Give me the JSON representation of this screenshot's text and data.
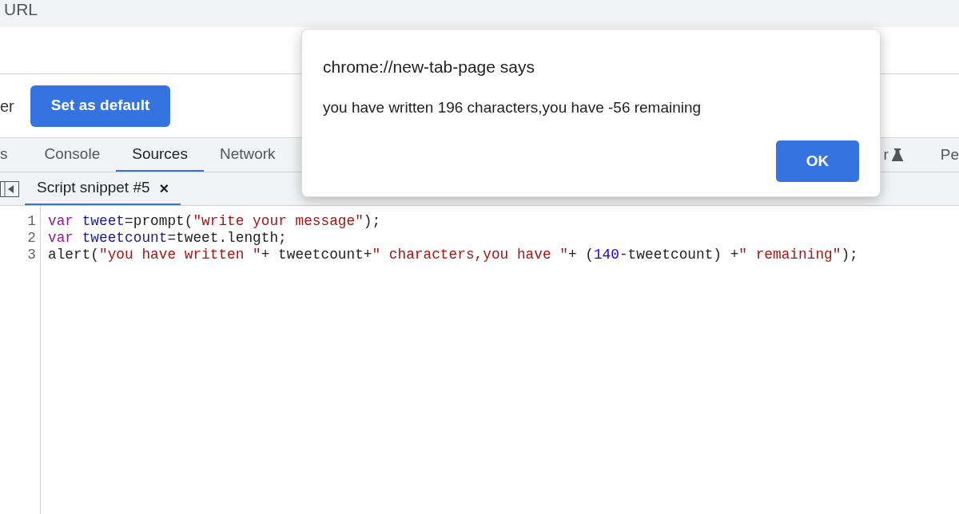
{
  "address_bar": {
    "text": "URL"
  },
  "banner": {
    "text": "er",
    "button": "Set as default"
  },
  "devtools_tabs": [
    {
      "label": "s",
      "selected": false
    },
    {
      "label": "Console",
      "selected": false
    },
    {
      "label": "Sources",
      "selected": true
    },
    {
      "label": "Network",
      "selected": false
    }
  ],
  "devtools_tabs_right": [
    {
      "label": "r",
      "kind": "flask"
    },
    {
      "label": "Pe",
      "kind": "plain"
    }
  ],
  "file_tabs": [
    {
      "label": "Script snippet #5",
      "close": "×",
      "selected": true
    }
  ],
  "code_lines": [
    {
      "number": "1",
      "tokens": [
        {
          "kind": "keyword",
          "text": "var "
        },
        {
          "kind": "variable",
          "text": "tweet"
        },
        {
          "kind": "plain",
          "text": "=prompt("
        },
        {
          "kind": "string",
          "text": "\"write your message\""
        },
        {
          "kind": "plain",
          "text": ");"
        }
      ]
    },
    {
      "number": "2",
      "tokens": [
        {
          "kind": "keyword",
          "text": "var "
        },
        {
          "kind": "variable",
          "text": "tweetcount"
        },
        {
          "kind": "plain",
          "text": "=tweet.length;"
        }
      ]
    },
    {
      "number": "3",
      "tokens": [
        {
          "kind": "plain",
          "text": "alert("
        },
        {
          "kind": "string",
          "text": "\"you have written \""
        },
        {
          "kind": "plain",
          "text": "+ tweetcount+"
        },
        {
          "kind": "string",
          "text": "\" characters,you have \""
        },
        {
          "kind": "plain",
          "text": "+ ("
        },
        {
          "kind": "number",
          "text": "140"
        },
        {
          "kind": "plain",
          "text": "-tweetcount) +"
        },
        {
          "kind": "string",
          "text": "\" remaining\""
        },
        {
          "kind": "plain",
          "text": ");"
        }
      ]
    }
  ],
  "dialog": {
    "title": "chrome://new-tab-page says",
    "message": "you have written 196 characters,you have -56 remaining",
    "button": "OK"
  }
}
